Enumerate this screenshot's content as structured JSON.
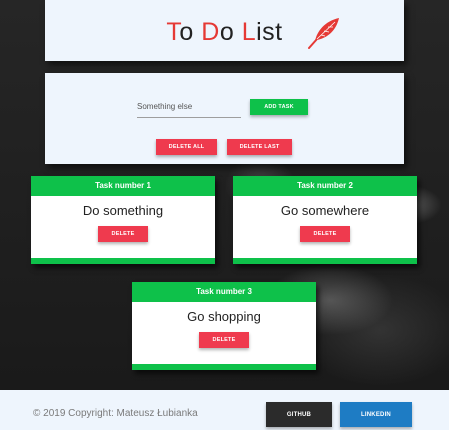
{
  "header": {
    "title_parts": [
      {
        "text": "T",
        "color": "#e53935"
      },
      {
        "text": "o ",
        "color": "#222222"
      },
      {
        "text": "D",
        "color": "#e53935"
      },
      {
        "text": "o ",
        "color": "#222222"
      },
      {
        "text": "L",
        "color": "#e53935"
      },
      {
        "text": "ist",
        "color": "#222222"
      }
    ],
    "logo_icon": "feather-icon"
  },
  "form": {
    "input_value": "Something else",
    "add_label": "ADD TASK",
    "delete_all_label": "DELETE ALL",
    "delete_last_label": "DELETE LAST"
  },
  "tasks": [
    {
      "header": "Task number 1",
      "text": "Do something",
      "delete_label": "DELETE"
    },
    {
      "header": "Task number 2",
      "text": "Go somewhere",
      "delete_label": "DELETE"
    },
    {
      "header": "Task number 3",
      "text": "Go shopping",
      "delete_label": "DELETE"
    }
  ],
  "footer": {
    "copyright": "© 2019 Copyright: Mateusz Łubianka",
    "github_label": "GITHUB",
    "linkedin_label": "LINKEDIN"
  },
  "colors": {
    "accent_green": "#0ec14a",
    "accent_red": "#ef3a4e",
    "panel_bg": "#eef5fd",
    "linkedin_blue": "#1e7cc4",
    "github_dark": "#2b2b2b"
  }
}
